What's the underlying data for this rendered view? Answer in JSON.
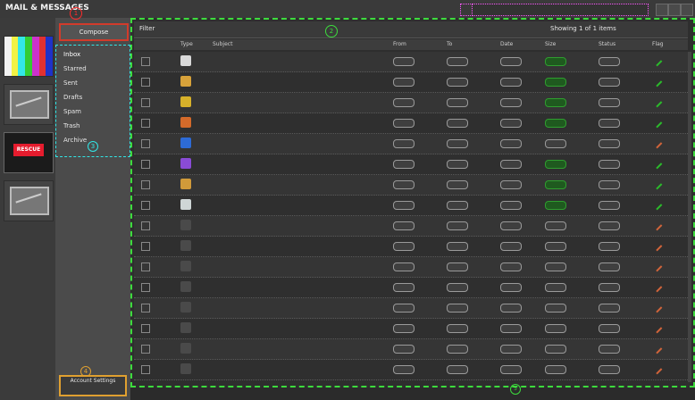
{
  "topbar": {
    "title": "MAIL & MESSAGES"
  },
  "rail": {
    "items": [
      {
        "name": "Broadcast",
        "kind": "test-card"
      },
      {
        "name": "Mail",
        "kind": "mailbox"
      },
      {
        "name": "Rescue",
        "kind": "rescue"
      },
      {
        "name": "Inbox",
        "kind": "mailbox"
      }
    ],
    "rescue_label": "RESCUE"
  },
  "folders": {
    "compose_label": "Compose",
    "compose_badge": "1",
    "folder_badge": "3",
    "account_badge": "4",
    "items": [
      "Inbox",
      "Starred",
      "Sent",
      "Drafts",
      "Spam",
      "Trash",
      "Archive"
    ],
    "account_label": "Account\nSettings"
  },
  "main": {
    "badge": "2",
    "bottom_badge": "5",
    "toolbar_left": "Filter",
    "toolbar_right": "Showing 1 of 1 items",
    "columns": [
      "",
      "Type",
      "Subject",
      "From",
      "To",
      "Date",
      "Size",
      "Status",
      "Flag"
    ]
  },
  "colors": {
    "accent_green": "#3ddc3d",
    "accent_cyan": "#31e7e7",
    "accent_red": "#d23b2b",
    "accent_orange": "#e0a030",
    "accent_magenta": "#ff59ff"
  }
}
